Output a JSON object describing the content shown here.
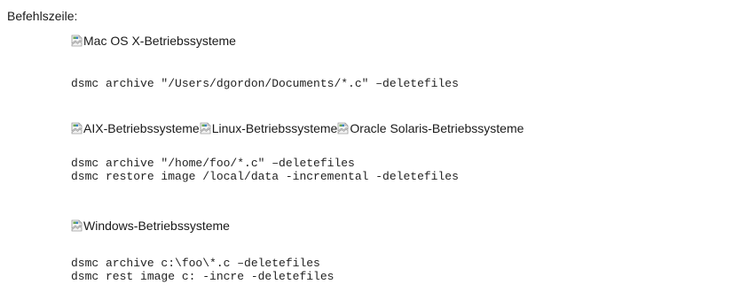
{
  "heading": "Befehlszeile:",
  "sections": [
    {
      "os_labels": [
        "Mac OS X-Betriebssysteme"
      ],
      "commands": [
        "dsmc archive \"/Users/dgordon/Documents/*.c\" –deletefiles"
      ]
    },
    {
      "os_labels": [
        "AIX-Betriebssysteme",
        "Linux-Betriebssysteme",
        "Oracle Solaris-Betriebssysteme"
      ],
      "commands": [
        "dsmc archive \"/home/foo/*.c\" –deletefiles",
        "dsmc restore image /local/data -incremental -deletefiles"
      ]
    },
    {
      "os_labels": [
        "Windows-Betriebssysteme"
      ],
      "commands": [
        "dsmc archive c:\\foo\\*.c –deletefiles",
        "dsmc rest image c: -incre -deletefiles"
      ]
    }
  ],
  "icon": "broken-image-icon"
}
